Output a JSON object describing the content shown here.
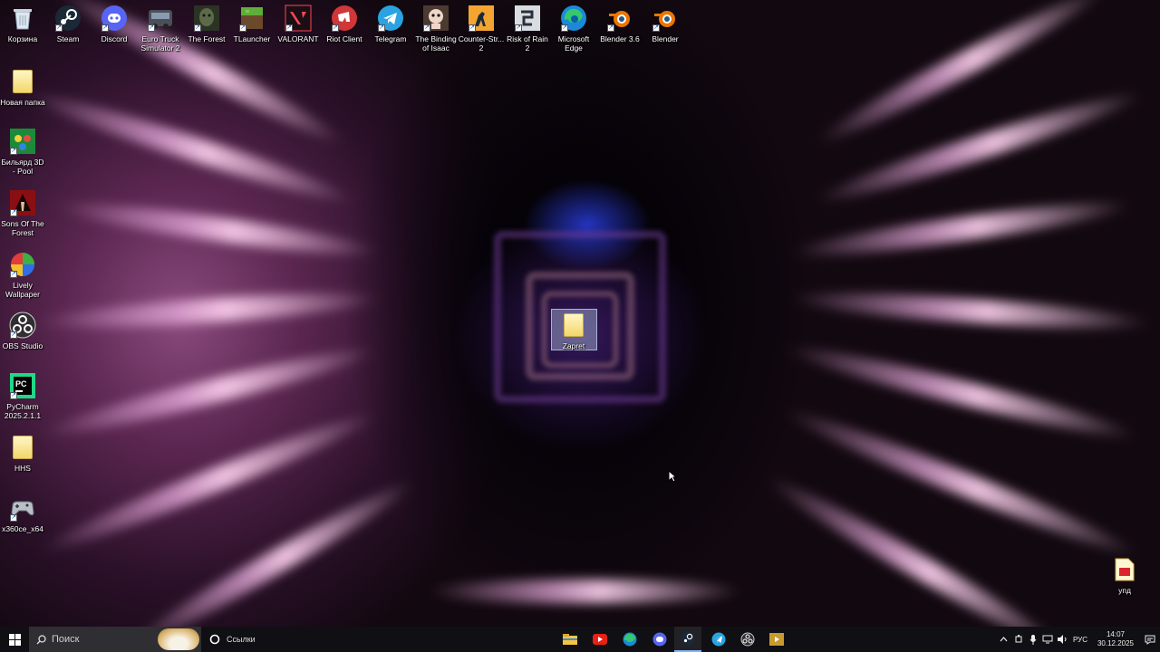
{
  "desktop": {
    "top_icons": [
      {
        "name": "recycle-bin-icon",
        "label": "Корзина",
        "shortcut": false
      },
      {
        "name": "steam-icon",
        "label": "Steam",
        "shortcut": true
      },
      {
        "name": "discord-icon",
        "label": "Discord",
        "shortcut": true
      },
      {
        "name": "euro-truck-icon",
        "label": "Euro Truck Simulator 2",
        "shortcut": true
      },
      {
        "name": "the-forest-icon",
        "label": "The Forest",
        "shortcut": true
      },
      {
        "name": "tlauncher-icon",
        "label": "TLauncher",
        "shortcut": true
      },
      {
        "name": "valorant-icon",
        "label": "VALORANT",
        "shortcut": true
      },
      {
        "name": "riot-client-icon",
        "label": "Riot Client",
        "shortcut": true
      },
      {
        "name": "telegram-icon",
        "label": "Telegram",
        "shortcut": true
      },
      {
        "name": "binding-of-isaac-icon",
        "label": "The Binding of Isaac",
        "shortcut": true
      },
      {
        "name": "counter-strike-icon",
        "label": "Counter-Str... 2",
        "shortcut": true
      },
      {
        "name": "risk-of-rain-icon",
        "label": "Risk of Rain 2",
        "shortcut": true
      },
      {
        "name": "edge-icon",
        "label": "Microsoft Edge",
        "shortcut": true
      },
      {
        "name": "blender-36-icon",
        "label": "Blender 3.6",
        "shortcut": true
      },
      {
        "name": "blender-icon",
        "label": "Blender",
        "shortcut": true
      }
    ],
    "left_icons": [
      {
        "name": "new-folder-icon",
        "label": "Новая папка",
        "shortcut": false
      },
      {
        "name": "billiard-icon",
        "label": "Бильярд 3D - Pool",
        "shortcut": true
      },
      {
        "name": "sons-of-the-forest-icon",
        "label": "Sons Of The Forest",
        "shortcut": true
      },
      {
        "name": "lively-wallpaper-icon",
        "label": "Lively Wallpaper",
        "shortcut": true
      },
      {
        "name": "obs-studio-icon",
        "label": "OBS Studio",
        "shortcut": true
      },
      {
        "name": "pycharm-icon",
        "label": "PyCharm 2025.2.1.1",
        "shortcut": true
      },
      {
        "name": "hhs-folder-icon",
        "label": "HHS",
        "shortcut": false
      },
      {
        "name": "x360ce-icon",
        "label": "x360ce_x64",
        "shortcut": true
      }
    ],
    "center_icon": {
      "label": "Zapret"
    },
    "right_icon": {
      "label": "упд"
    }
  },
  "taskbar": {
    "search_placeholder": "Поиск",
    "links_label": "Ссылки",
    "apps": [
      "file-explorer-icon",
      "youtube-icon",
      "edge-icon",
      "discord-icon",
      "steam-icon",
      "telegram-icon",
      "obs-icon",
      "media-player-icon"
    ],
    "active_app": "steam-icon",
    "language": "РУС",
    "time": "14:07",
    "date": "30.12.2025"
  },
  "colors": {
    "taskbar_bg": "#101014",
    "search_bg": "#2e2e33",
    "active_indicator": "#7fb2ff"
  }
}
